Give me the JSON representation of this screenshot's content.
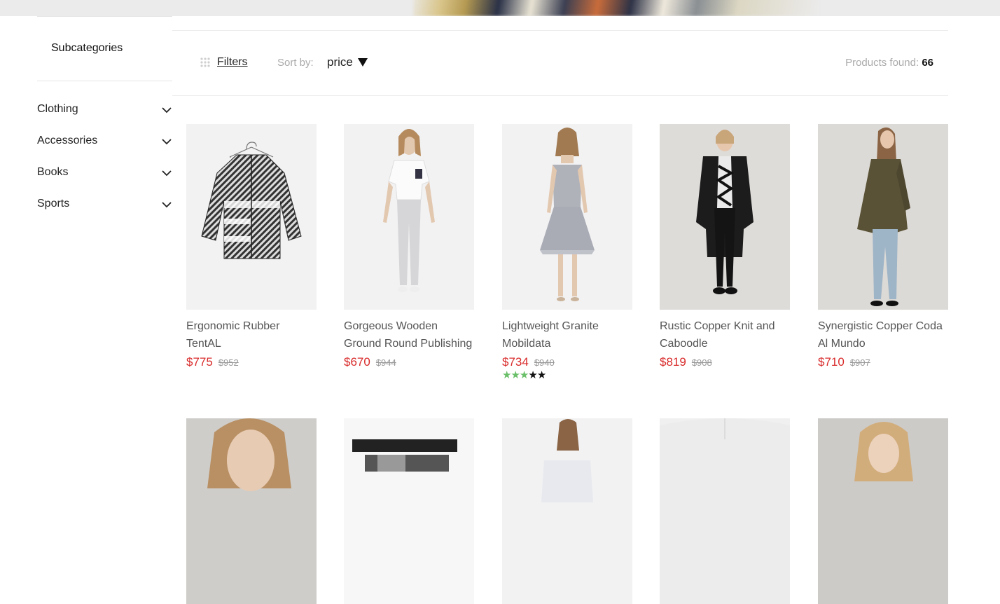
{
  "sidebar": {
    "title": "Subcategories",
    "categories": [
      {
        "label": "Clothing"
      },
      {
        "label": "Accessories"
      },
      {
        "label": "Books"
      },
      {
        "label": "Sports"
      }
    ]
  },
  "toolbar": {
    "filters_label": "Filters",
    "sort_label": "Sort by:",
    "sort_value": "price",
    "products_found_label": "Products found:",
    "products_found_count": "66"
  },
  "products": [
    {
      "name": "Ergonomic Rubber TentAL",
      "price": "$775",
      "old_price": "$952"
    },
    {
      "name": "Gorgeous Wooden Ground Round Publishing",
      "price": "$670",
      "old_price": "$944"
    },
    {
      "name": "Lightweight Granite Mobildata",
      "price": "$734",
      "old_price": "$940",
      "rating": 3,
      "rating_max": 5
    },
    {
      "name": "Rustic Copper Knit and Caboodle",
      "price": "$819",
      "old_price": "$908"
    },
    {
      "name": "Synergistic Copper Coda Al Mundo",
      "price": "$710",
      "old_price": "$907"
    }
  ],
  "colors": {
    "price": "#d92b2b",
    "old_price": "#999999",
    "star_on": "#6abf69",
    "star_off": "#111111",
    "image_bg": "#f2f2f3"
  },
  "icons": {
    "filters": "grid-dots-icon",
    "sort": "triangle-down-icon",
    "category_toggle": "chevron-down-icon"
  }
}
